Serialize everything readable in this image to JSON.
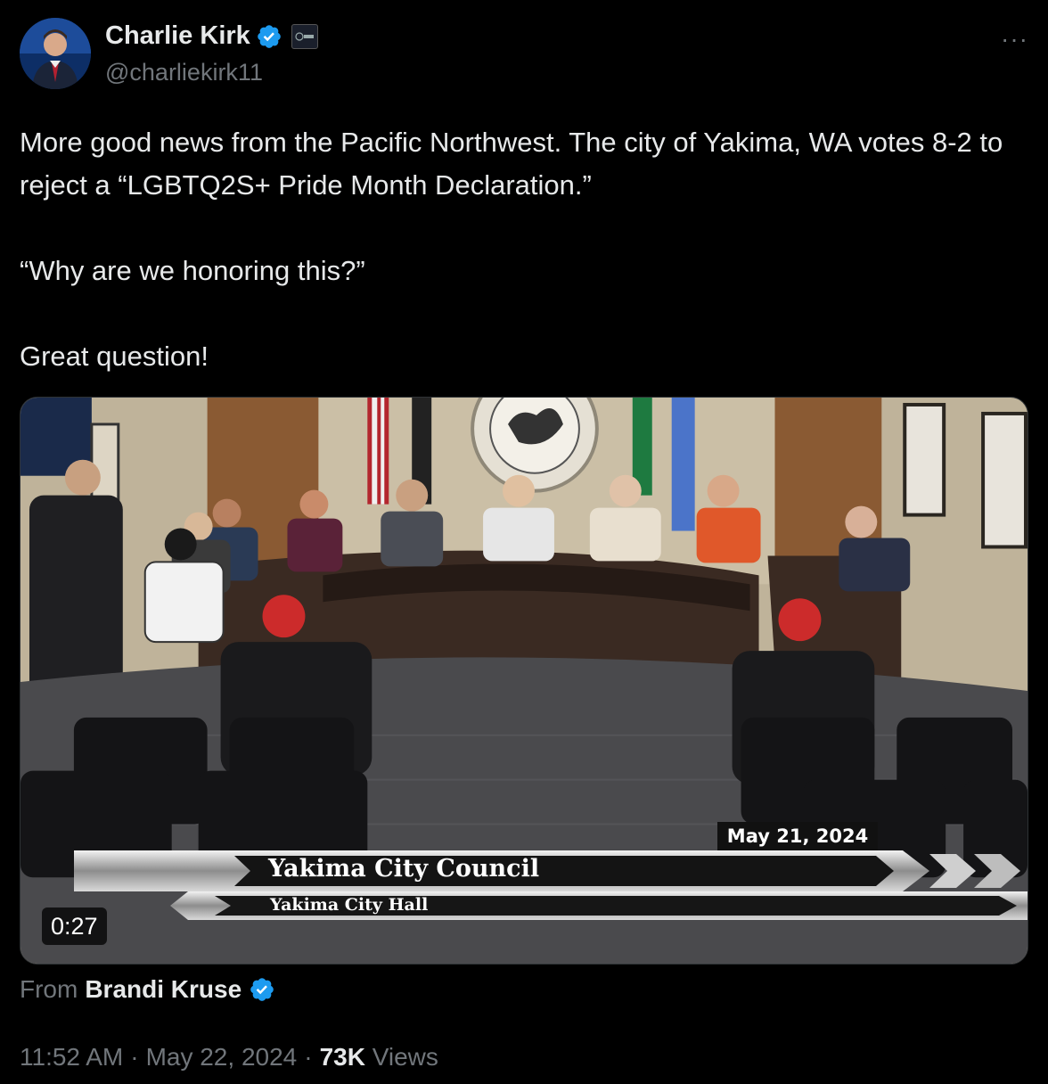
{
  "author": {
    "display_name": "Charlie Kirk",
    "handle": "@charliekirk11",
    "affiliation_badge": "TPUSA",
    "verified": true
  },
  "menu": {
    "more_label": "···"
  },
  "tweet": {
    "text": "More good news from the Pacific Northwest. The city of Yakima, WA votes 8-2 to reject a “LGBTQ2S+ Pride Month Declaration.”\n\n“Why are we honoring this?”\n\nGreat question!"
  },
  "video": {
    "duration": "0:27",
    "overlay_date": "May 21, 2024",
    "overlay_title": "Yakima City Council",
    "overlay_subtitle": "Yakima City Hall"
  },
  "source": {
    "from_label": "From",
    "from_name": "Brandi Kruse",
    "verified": true
  },
  "meta": {
    "time": "11:52 AM",
    "separator": "·",
    "date": "May 22, 2024",
    "views_count": "73K",
    "views_label": "Views"
  },
  "colors": {
    "background": "#000000",
    "text_primary": "#e7e9ea",
    "text_secondary": "#71767b",
    "verified_blue": "#1d9bf0"
  }
}
